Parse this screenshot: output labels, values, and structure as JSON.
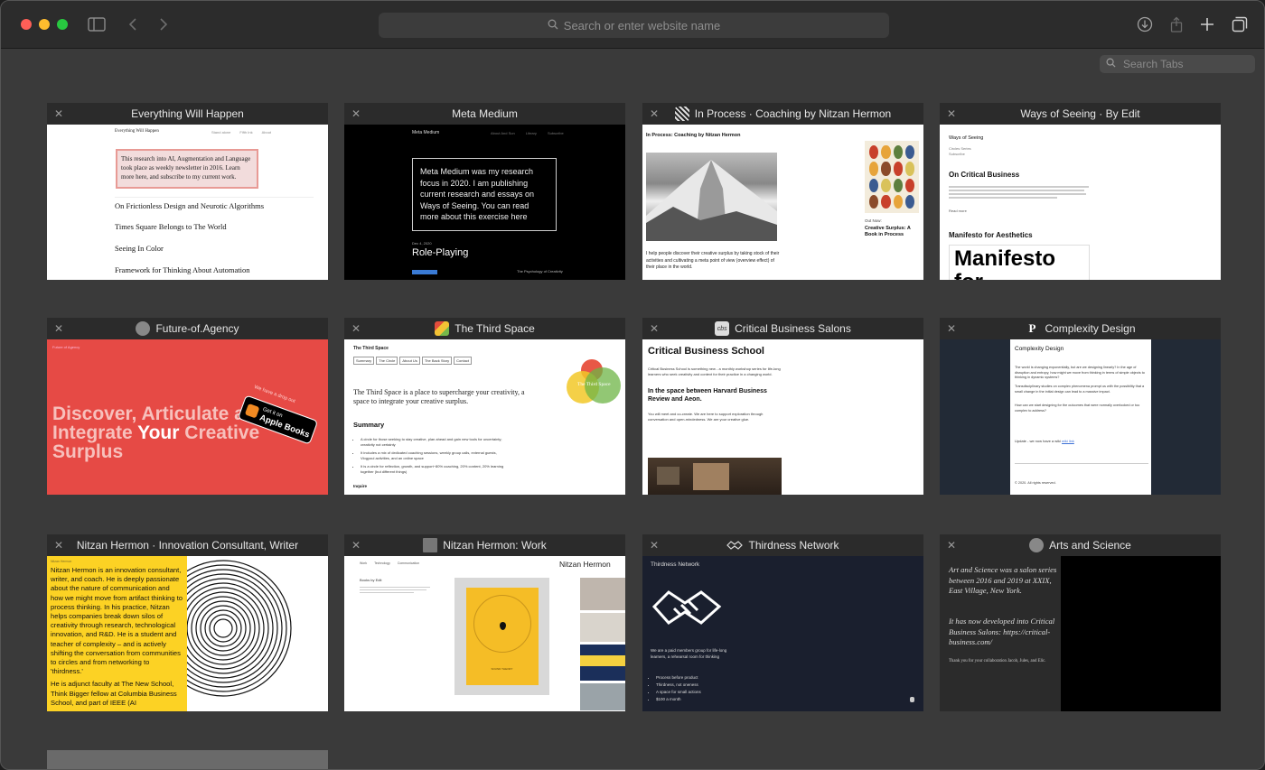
{
  "toolbar": {
    "address_placeholder": "Search or enter website name",
    "tab_search_placeholder": "Search Tabs"
  },
  "tabs": [
    {
      "title": "Everything Will Happen",
      "favicon": "none"
    },
    {
      "title": "Meta Medium",
      "favicon": "none"
    },
    {
      "title": "In Process · Coaching by Nitzan Hermon",
      "favicon": "qr-icon"
    },
    {
      "title": "Ways of Seeing · By Edit",
      "favicon": "none"
    },
    {
      "title": "Future-of.Agency",
      "favicon": "circle-icon"
    },
    {
      "title": "The Third Space",
      "favicon": "colorful-icon"
    },
    {
      "title": "Critical Business Salons",
      "favicon": "cbs-icon"
    },
    {
      "title": "Complexity Design",
      "favicon": "p-icon"
    },
    {
      "title": "Nitzan Hermon · Innovation Consultant, Writer",
      "favicon": "none"
    },
    {
      "title": "Nitzan Hermon: Work",
      "favicon": "grey-square-icon"
    },
    {
      "title": "Thirdness Network",
      "favicon": "handshake-icon"
    },
    {
      "title": "Arts and Science",
      "favicon": "circle-icon"
    }
  ],
  "t1": {
    "header": "Everything Will Happen",
    "nav": [
      "Stand alone",
      "Fifth Ink",
      "About"
    ],
    "intro": "This research into AI, Augmentation and Language took place as weekly newsletter in 2016. Learn more here, and subscribe to my current work.",
    "posts": [
      "On Frictionless Design and Neurotic Algorithms",
      "Times Square Belongs to The World",
      "Seeing In Color",
      "Framework for Thinking About Automation"
    ]
  },
  "t2": {
    "header": "Meta Medium",
    "nav": [
      "About And Sun",
      "Library",
      "Subscribe"
    ],
    "box": "Meta Medium was my research focus in 2020. I am publishing current research and essays on Ways of Seeing. You can read more about this exercise here",
    "date": "Dec 4, 2020",
    "post": "Role-Playing",
    "sub": "The Psychology of Creativity"
  },
  "t3": {
    "heading": "In Process: Coaching by Nitzan Hermon",
    "body": "I help people discover their creative surplus by taking stock of their activities and cultivating a meta point of view (overview effect) of their place in the world.",
    "side_label": "Out Now:",
    "side_title": "Creative Surplus: A Book in Process"
  },
  "t4": {
    "header": "Ways of Seeing",
    "nav": [
      "Circles Series",
      "Subscribe"
    ],
    "post1": "On Critical Business",
    "post1_meta": "Read more",
    "post2": "Manifesto for Aesthetics",
    "big": "Manifesto for"
  },
  "t5": {
    "header": "Future of Agency",
    "headline1": "Discover, Articulate and",
    "headline2a": "Integrate ",
    "headline2b": "Your",
    "headline2c": " Creative",
    "headline3": "Surplus",
    "badge_small": "Get it on",
    "badge_big": "Apple Books",
    "badge_top": "We have a drop out"
  },
  "t6": {
    "header": "The Third Space",
    "nav": [
      "Summary",
      "The Circle",
      "About Us",
      "The Back Story",
      "Contact"
    ],
    "intro": "The Third Space is a place to supercharge your creativity, a space to integrate your creative surplus.",
    "summary": "Summary",
    "bullets": [
      "A circle for those seeking to stay creative, plan ahead and gain new tools for uncertainty; creativity not certainty",
      "It includes a mix of dedicated coaching sessions, weekly group calls, external guests, Vlogyoul activities, and an online space",
      "It is a circle for reflection, growth, and support~80% coaching, 20% content, 20% learning together (but different things)"
    ],
    "inquire": "Inquire",
    "logo_text": "The Third Space"
  },
  "t7": {
    "heading": "Critical Business School",
    "p1": "Critical Business School is something new - a monthly workshop series for life-long learners who seek creativity and context for their practice in a changing world.",
    "sub": "In the space between Harvard Business Review and Aeon.",
    "p2": "You will meet and co-create. We are here to support exploration through conversation and open-mindedness. We are your creative glue."
  },
  "t8": {
    "header": "Complexity Design",
    "p1": "The world is changing exponentially, but are we designing linearly? In the age of disruption and entropy, how might we move from thinking in terms of simple objects to thinking in dynamic systems?",
    "p2": "Transdisciplinary studies on complex phenomena prompt us with the possibility that a small change in the initial design can lead to a massive impact.",
    "p3": "How can we start designing for the outcomes that were normally overlooked or too complex to address?",
    "update": "Update - we now have a wiki",
    "footer": "© 2020. All rights reserved."
  },
  "t9": {
    "header": "Nitzan Hermon",
    "bio": "Nitzan Hermon is an innovation consultant, writer, and coach. He is deeply passionate about the nature of communication and how we might move from artifact thinking to process thinking. In his practice, Nitzan helps companies break down silos of creativity through research, technological innovation, and R&D. He is a student and teacher of complexity – and is actively shifting the conversation from communities to circles and from networking to 'thirdness.'",
    "bio2": "He is adjunct faculty at The New School, Think Bigger fellow at Columbia Business School, and part of IEEE (AI"
  },
  "t10": {
    "nav": [
      "Work",
      "Technology",
      "Communication"
    ],
    "title": "Nitzan Hermon",
    "sub": "Books by Edit",
    "poster_text": "SOUND THEORY"
  },
  "t11": {
    "header": "Thirdness Network",
    "p1": "We are a paid members group for life-long learners, a rehearsal room for thinking",
    "bullets": [
      "Process before product",
      "Thirdness, not oneness",
      "A space for small actions",
      "$100 a month"
    ]
  },
  "t12": {
    "p1": "Art and Science was a salon series between 2016 and 2019 at XXIX, East Village, New York.",
    "p2": "It has now developed into Critical Business Salons: https://critical-business.com/",
    "p3": "Thank you for your collaboration Jacob, Jules, and Elic."
  }
}
